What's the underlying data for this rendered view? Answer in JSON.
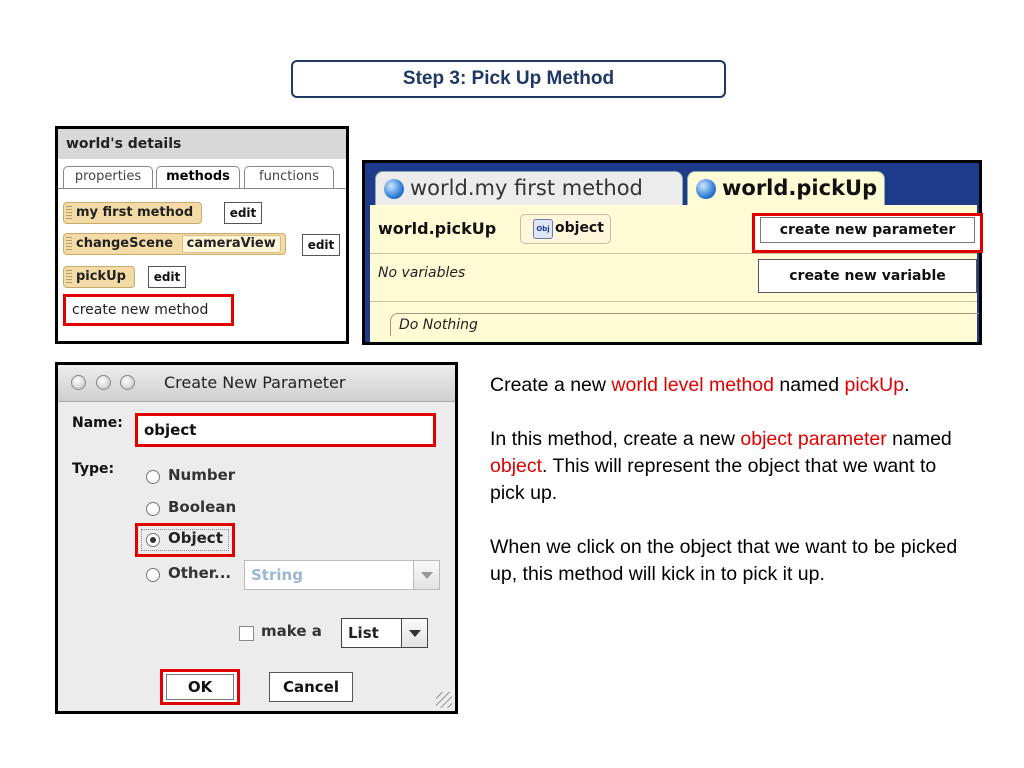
{
  "title": "Step 3: Pick Up Method",
  "details_panel": {
    "header": "world's details",
    "tabs": [
      "properties",
      "methods",
      "functions"
    ],
    "methods": [
      {
        "name": "my first method",
        "edit": "edit"
      },
      {
        "name": "changeScene",
        "param": "cameraView",
        "edit": "edit"
      },
      {
        "name": "pickUp",
        "edit": "edit"
      }
    ],
    "create_method": "create new method"
  },
  "editor": {
    "tabs": [
      "world.my first method",
      "world.pickUp"
    ],
    "method_title": "world.pickUp",
    "param_icon": "Obj",
    "param_name": "object",
    "create_param": "create new parameter",
    "no_vars": "No variables",
    "create_var": "create new variable",
    "do_nothing": "Do Nothing"
  },
  "dialog": {
    "title": "Create New Parameter",
    "name_label": "Name:",
    "name_value": "object",
    "type_label": "Type:",
    "types": [
      "Number",
      "Boolean",
      "Object",
      "Other..."
    ],
    "selected_type": "Object",
    "other_value": "String",
    "make_a": "make a",
    "list_value": "List",
    "ok": "OK",
    "cancel": "Cancel"
  },
  "instructions": {
    "p1": {
      "a": "Create a new ",
      "b": "world level method",
      "c": " named ",
      "d": "pickUp",
      "e": "."
    },
    "p2": {
      "a": "In this method, create a new ",
      "b": "object parameter",
      "c": " named ",
      "d": "object",
      "e": ". This will represent the object that we want to pick up."
    },
    "p3": "When we click on the object that we want to be picked up, this method will kick in to pick it up."
  },
  "colors": {
    "highlight": "#e00000",
    "title_border": "#1f3864",
    "editor_blue": "#1e3a8a",
    "method_pill": "#f3dba8"
  }
}
